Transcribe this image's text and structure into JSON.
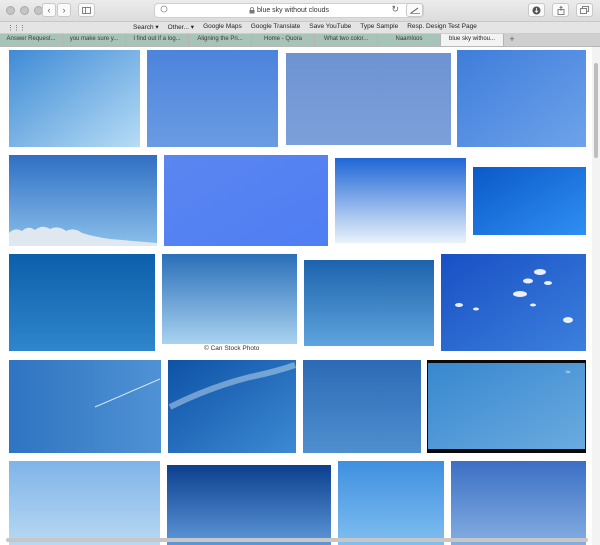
{
  "browser": {
    "url_text": "blue sky without clouds",
    "back_glyph": "‹",
    "forward_glyph": "›",
    "icons": [
      "sidebar-icon",
      "search-icon",
      "lock-icon",
      "reload-icon",
      "download-icon",
      "share-icon",
      "tabs-icon"
    ]
  },
  "favorites": {
    "items": [
      "Search ▾",
      "Other... ▾",
      "Google Maps",
      "Google Translate",
      "Save YouTube",
      "Type Sample",
      "Resp. Design Test Page"
    ]
  },
  "tabs": [
    {
      "label": "Answer Request..."
    },
    {
      "label": "you make sure y..."
    },
    {
      "label": "I find out if a log..."
    },
    {
      "label": "Aligning the Pri..."
    },
    {
      "label": "Home - Quora"
    },
    {
      "label": "What two color..."
    },
    {
      "label": "Naamloos"
    },
    {
      "label": "blue sky withou..."
    }
  ],
  "gallery": {
    "credit": "© Can Stock Photo",
    "colors": {
      "accent_blue": "#3f7fe0",
      "deep_blue": "#0f5ea8",
      "pale_blue": "#9cc8ee"
    }
  }
}
